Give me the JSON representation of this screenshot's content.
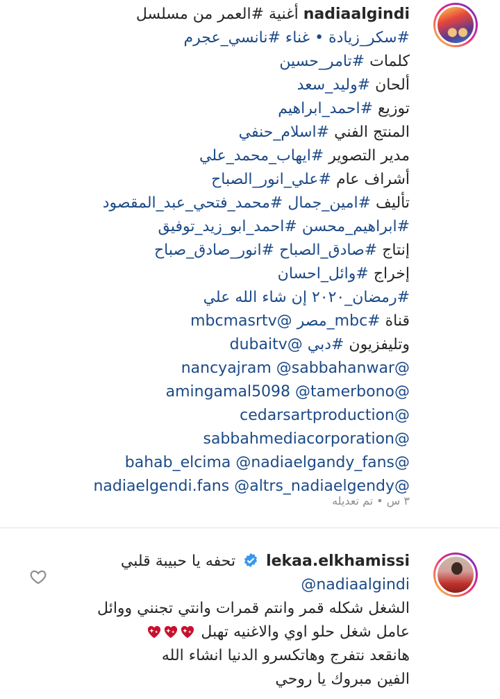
{
  "post": {
    "username": "nadiaalgindi",
    "avatar_icon": "avatar-photo",
    "line1_rest": "أغنية #العمر من مسلسل",
    "lines": [
      {
        "text": "#سكر_زيادة • غناء #نانسي_عجرم"
      },
      {
        "text": "كلمات #تامر_حسين"
      },
      {
        "text": "ألحان #وليد_سعد"
      },
      {
        "text": "توزيع #احمد_ابراهيم"
      },
      {
        "text": "المنتج الفني #اسلام_حنفي"
      },
      {
        "text": "مدير التصوير #ايهاب_محمد_علي"
      },
      {
        "text": "أشراف عام #علي_انور_الصباح"
      },
      {
        "text": "تأليف #امين_جمال #محمد_فتحي_عبد_المقصود"
      },
      {
        "text": "#ابراهيم_محسن #احمد_ابو_زيد_توفيق"
      },
      {
        "text": "إنتاج #صادق_الصباح #انور_صادق_صباح"
      },
      {
        "text": "إخراج #وائل_احسان"
      },
      {
        "text": "#رمضان_٢٠٢٠ إن شاء الله علي"
      },
      {
        "text": "قناة #mbc_مصر @mbcmasrtv"
      },
      {
        "text": "وتليفزيون #دبي @dubaitv"
      },
      {
        "text": "@nancyajram @sabbahanwar"
      },
      {
        "text": "@amingamal5098 @tamerbono"
      },
      {
        "text": "@cedarsartproduction"
      },
      {
        "text": "@sabbahmediacorporation"
      },
      {
        "text": "@bahab_elcima @nadiaelgandy_fans"
      },
      {
        "text": "@nadiaelgendi.fans @altrs_nadiaelgendy"
      }
    ],
    "meta": "٣ س • تم تعديله"
  },
  "comment": {
    "username": "lekaa.elkhamissi",
    "verified_icon": "verified-badge-icon",
    "line1_rest": "تحفه يا حبيبة قلبي",
    "mention": "@nadiaalgindi",
    "line3": "الشغل شكله قمر وانتم قمرات وانتي تجنني ووائل",
    "line4": "عامل شغل حلو اوي والاغنيه تهبل",
    "line5": "هانقعد نتفرج وهاتكسرو الدنيا انشاء الله",
    "line6": "الفين مبروك يا روحي",
    "like_icon": "heart-outline-icon",
    "emoji_icon": "sparkling-heart-icon",
    "heart_color": "#c8102e"
  },
  "colors": {
    "hashtag": "#1c4a87",
    "text": "#262626",
    "meta": "#8e8e8e",
    "verified": "#3897f0"
  }
}
